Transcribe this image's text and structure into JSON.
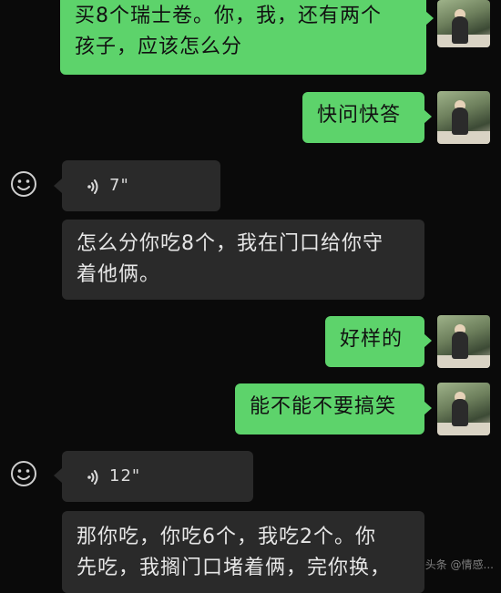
{
  "messages": [
    {
      "id": "m1",
      "side": "out",
      "type": "text",
      "lines": [
        "买8个瑞士卷。你，我，还有两个",
        "孩子，应该怎么分"
      ]
    },
    {
      "id": "m2",
      "side": "out",
      "type": "text",
      "lines": [
        "快问快答"
      ]
    },
    {
      "id": "m3",
      "side": "in",
      "type": "voice",
      "duration": "7\""
    },
    {
      "id": "m4",
      "side": "in",
      "type": "text",
      "lines": [
        "怎么分你吃8个，我在门口给你守",
        "着他俩。"
      ]
    },
    {
      "id": "m5",
      "side": "out",
      "type": "text",
      "lines": [
        "好样的"
      ]
    },
    {
      "id": "m6",
      "side": "out",
      "type": "text",
      "lines": [
        "能不能不要搞笑"
      ]
    },
    {
      "id": "m7",
      "side": "in",
      "type": "voice",
      "duration": "12\""
    },
    {
      "id": "m8",
      "side": "in",
      "type": "text",
      "lines": [
        "那你吃，你吃6个，我吃2个。你",
        "先吃，我搁门口堵着俩，完你换，"
      ]
    }
  ],
  "colors": {
    "background": "#0a0a0a",
    "outgoing_bubble": "#5dd36b",
    "incoming_bubble": "#2a2a2a"
  },
  "icons": {
    "voice": "voice-wave-icon",
    "other_avatar": "smiley-face-icon"
  },
  "watermark": "头条 @情感..."
}
